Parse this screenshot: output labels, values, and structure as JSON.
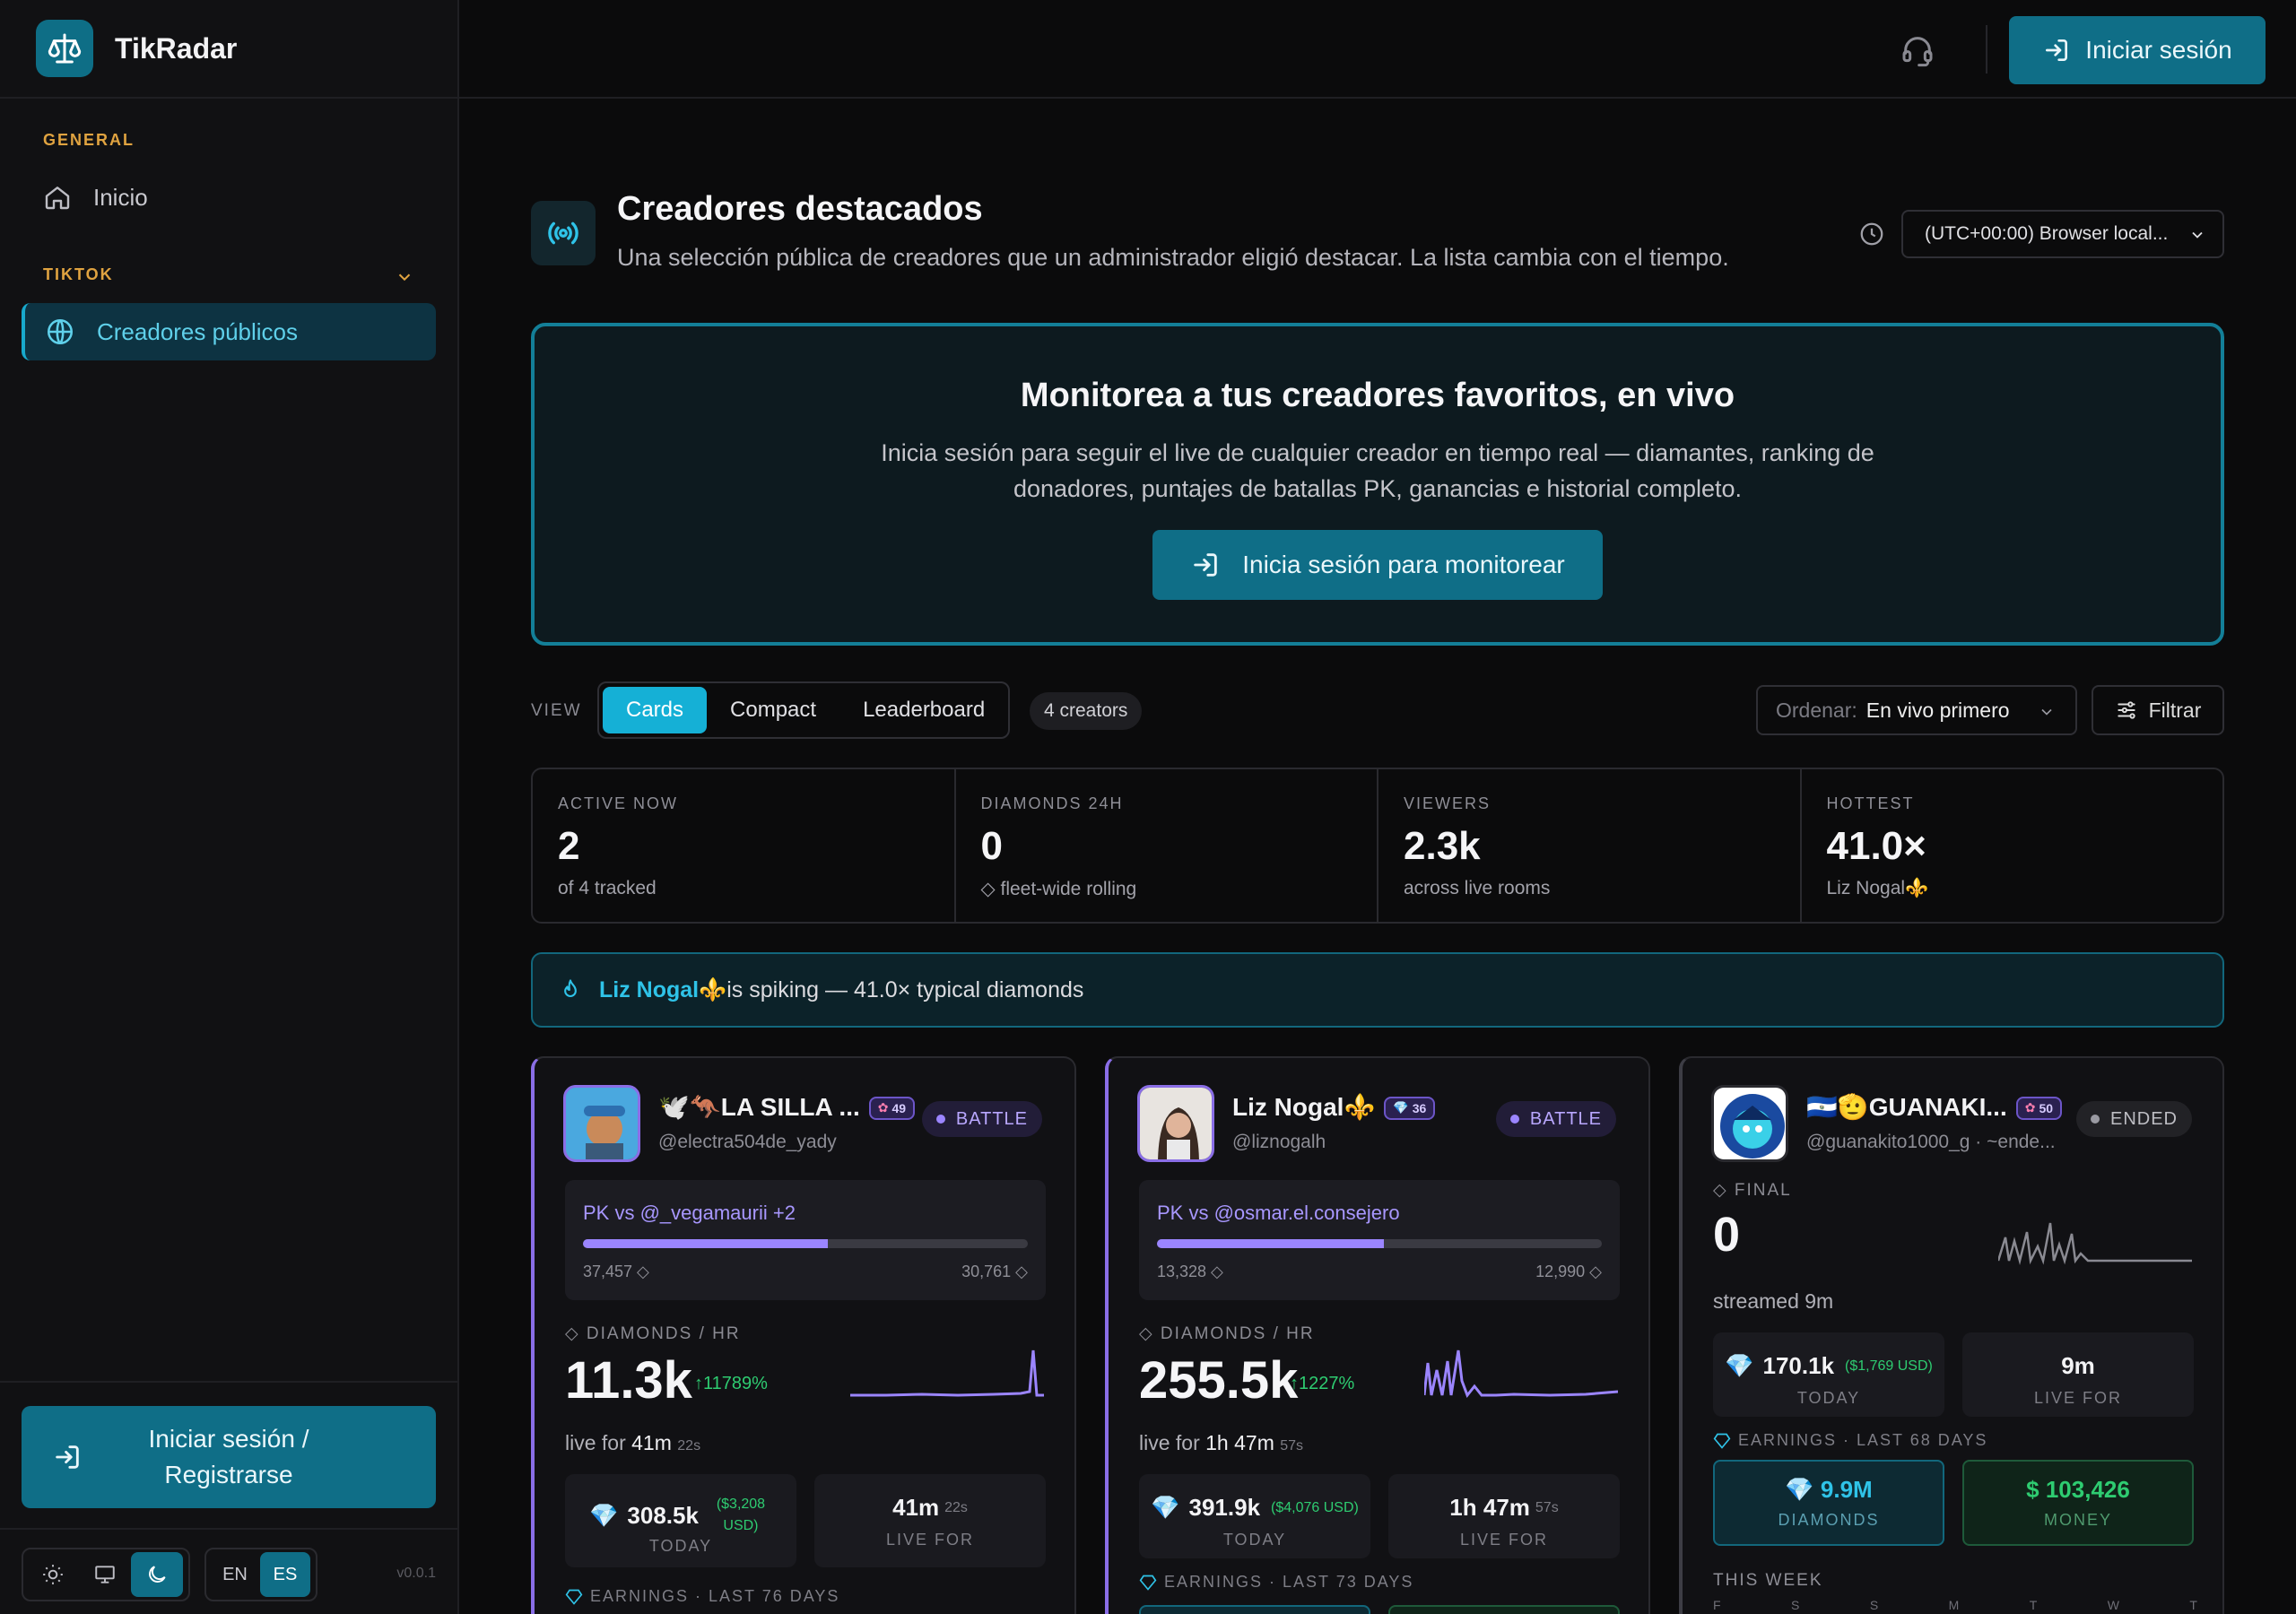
{
  "app": {
    "name": "TikRadar",
    "version": "v0.0.1"
  },
  "sidebar": {
    "sections": [
      {
        "label": "GENERAL",
        "items": [
          {
            "label": "Inicio",
            "icon": "home-icon"
          }
        ]
      },
      {
        "label": "TIKTOK",
        "items": [
          {
            "label": "Creadores públicos",
            "icon": "globe-icon",
            "active": true
          }
        ]
      }
    ],
    "signin_line1": "Iniciar sesión /",
    "signin_line2": "Registrarse",
    "lang": {
      "en": "EN",
      "es": "ES",
      "active": "ES"
    },
    "theme_active": "dark"
  },
  "topbar": {
    "signin": "Iniciar sesión"
  },
  "page": {
    "title": "Creadores destacados",
    "subtitle": "Una selección pública de creadores que un administrador eligió destacar. La lista cambia con el tiempo.",
    "timezone": "(UTC+00:00) Browser local..."
  },
  "hero": {
    "title": "Monitorea a tus creadores favoritos, en vivo",
    "text": "Inicia sesión para seguir el live de cualquier creador en tiempo real — diamantes, ranking de donadores, puntajes de batallas PK, ganancias e historial completo.",
    "button": "Inicia sesión para monitorear"
  },
  "view": {
    "label": "VIEW",
    "tabs": [
      "Cards",
      "Compact",
      "Leaderboard"
    ],
    "active": "Cards",
    "count": "4 creators",
    "sort_key": "Ordenar:",
    "sort_value": "En vivo primero",
    "filter": "Filtrar"
  },
  "stats": [
    {
      "key": "ACTIVE NOW",
      "value": "2",
      "sub": "of 4 tracked"
    },
    {
      "key": "DIAMONDS 24H",
      "value": "0",
      "sub": "◇ fleet-wide rolling"
    },
    {
      "key": "VIEWERS",
      "value": "2.3k",
      "sub": "across live rooms"
    },
    {
      "key": "HOTTEST",
      "value": "41.0×",
      "sub": "Liz Nogal⚜️"
    }
  ],
  "alert": {
    "name": "Liz Nogal⚜️",
    "text": " is spiking — 41.0× typical diamonds"
  },
  "cards": [
    {
      "name": "🕊️🦘LA SILLA ...",
      "level": "49",
      "handle": "@electra504de_yady",
      "status": "BATTLE",
      "pk_title": "PK vs @_vegamaurii +2",
      "pk_left": "37,457 ◇",
      "pk_right": "30,761 ◇",
      "pk_ratio": 0.55,
      "dph_label": "◇ DIAMONDS / HR",
      "dph_value": "11.3k",
      "dph_pct": "↑11789%",
      "live_prefix": "live for ",
      "live_main": "41m",
      "live_sec": "22s",
      "today_value": "308.5k",
      "today_usd": "($3,208 USD)",
      "today_label": "TODAY",
      "livefor_value": "41m",
      "livefor_sec": "22s",
      "livefor_label": "LIVE FOR",
      "earnings": "EARNINGS · LAST 76 DAYS"
    },
    {
      "name": "Liz Nogal⚜️",
      "level": "36",
      "handle": "@liznogalh",
      "status": "BATTLE",
      "pk_title": "PK vs @osmar.el.consejero",
      "pk_left": "13,328 ◇",
      "pk_right": "12,990 ◇",
      "pk_ratio": 0.51,
      "dph_label": "◇ DIAMONDS / HR",
      "dph_value": "255.5k",
      "dph_pct": "↑1227%",
      "live_prefix": "live for ",
      "live_main": "1h 47m",
      "live_sec": "57s",
      "today_value": "391.9k",
      "today_usd": "($4,076 USD)",
      "today_label": "TODAY",
      "livefor_value": "1h 47m",
      "livefor_sec": "57s",
      "livefor_label": "LIVE FOR",
      "earnings": "EARNINGS · LAST 73 DAYS"
    },
    {
      "name": "🇸🇻🫡GUANAKI...",
      "level": "50",
      "handle": "@guanakito1000_g · ~ende...",
      "status": "ENDED",
      "final_label": "◇ FINAL",
      "final_value": "0",
      "streamed": "streamed 9m",
      "today_value": "170.1k",
      "today_usd": "($1,769 USD)",
      "today_label": "TODAY",
      "livefor_value": "9m",
      "livefor_label": "LIVE FOR",
      "earnings": "EARNINGS · LAST 68 DAYS",
      "diamonds_value": "9.9M",
      "diamonds_label": "DIAMONDS",
      "money_value": "$ 103,426",
      "money_label": "MONEY",
      "week_label": "THIS WEEK",
      "days": [
        "F",
        "S",
        "S",
        "M",
        "T",
        "W",
        "T"
      ]
    }
  ],
  "colors": {
    "accent": "#0f6e87",
    "cyan": "#15b0d6",
    "purple": "#9b85ff",
    "green": "#2ecc71",
    "orange": "#e0a340"
  }
}
